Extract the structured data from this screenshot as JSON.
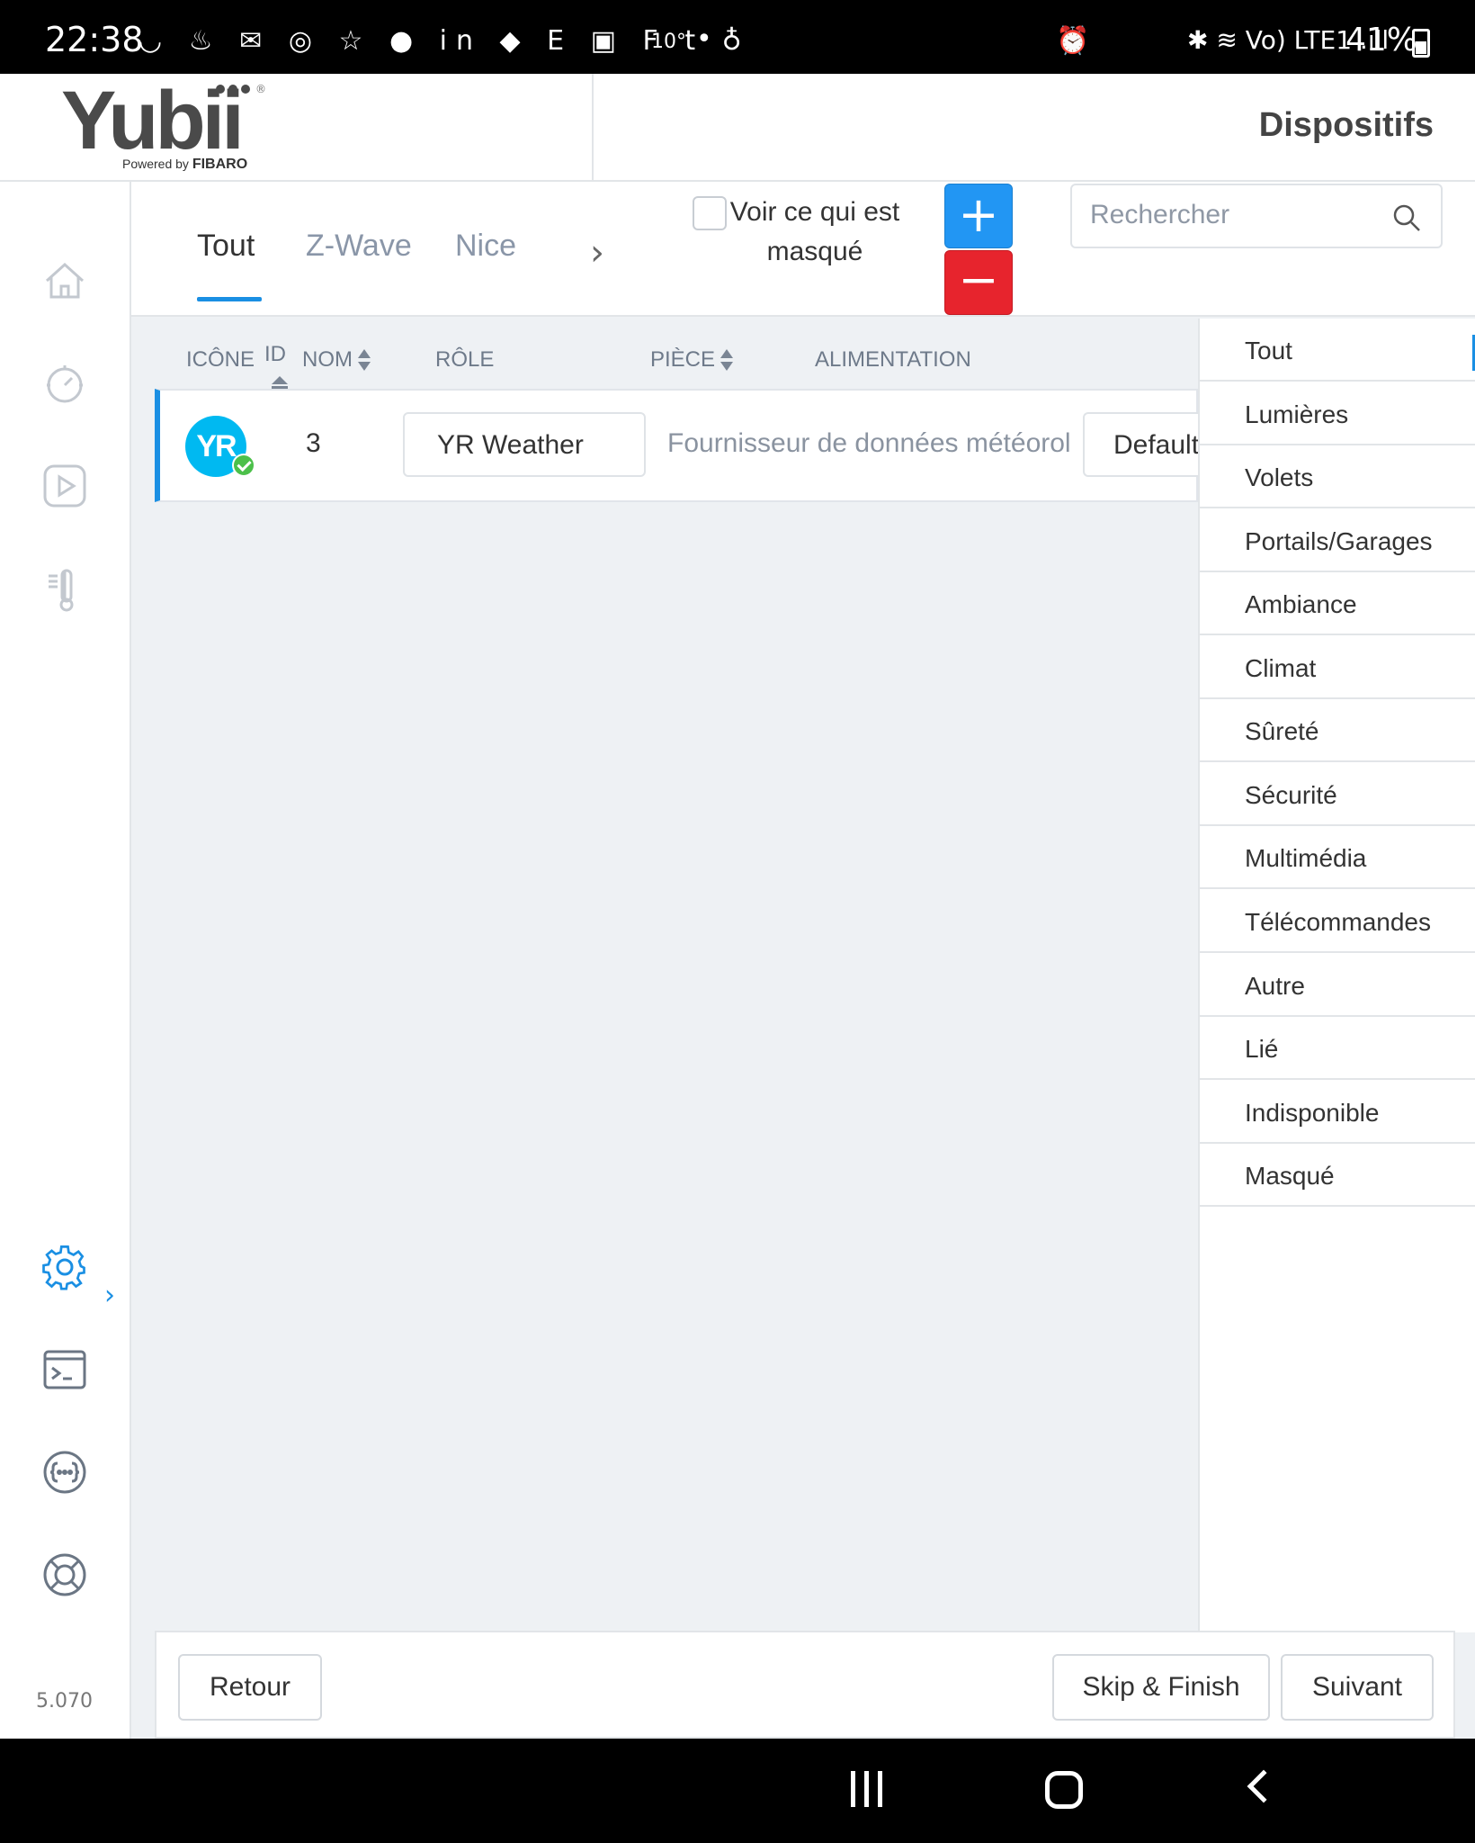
{
  "status_bar": {
    "time": "22:38",
    "notification_icons": "◡ ♨ ✉ ◎ ☆ ● in ◆ E ▣ F t ♁",
    "temperature": "10°",
    "dot": "•",
    "alarm_icon": "⏰",
    "right_icons": "✱ ≋ Vo) LTE1 .ıll",
    "battery": "41%"
  },
  "header": {
    "logo": {
      "text": "Yubii",
      "registered": "®",
      "powered_by": "Powered by",
      "brand": "FIBARO"
    },
    "title": "Dispositifs"
  },
  "sidebar": {
    "items": [
      {
        "icon": "home-icon"
      },
      {
        "icon": "dashboard-clock-icon"
      },
      {
        "icon": "scenes-play-icon"
      },
      {
        "icon": "thermometer-icon"
      },
      {
        "icon": "settings-gear-icon",
        "active": true
      },
      {
        "icon": "terminal-icon"
      },
      {
        "icon": "plugins-braces-icon"
      },
      {
        "icon": "help-lifebuoy-icon"
      }
    ],
    "version": "5.070"
  },
  "tabs": {
    "items": [
      {
        "label": "Tout",
        "active": true
      },
      {
        "label": "Z-Wave"
      },
      {
        "label": "Nice"
      }
    ],
    "next_icon": "chevron-right-icon"
  },
  "toolbar": {
    "show_hidden_label": "Voir ce qui est masqué",
    "show_hidden_checked": false,
    "add_label": "+",
    "remove_label": "−",
    "search_placeholder": "Rechercher"
  },
  "table": {
    "columns": {
      "icon": "ICÔNE",
      "id": "ID",
      "name": "NOM",
      "role": "RÔLE",
      "room": "PIÈCE",
      "power": "ALIMENTATION"
    },
    "rows": [
      {
        "icon_text": "YR",
        "id": "3",
        "name": "YR Weather",
        "role": "Fournisseur de données météorol",
        "room": "Default"
      }
    ]
  },
  "category_menu": {
    "items": [
      "Tout",
      "Lumières",
      "Volets",
      "Portails/Garages",
      "Ambiance",
      "Climat",
      "Sûreté",
      "Sécurité",
      "Multimédia",
      "Télécommandes",
      "Autre",
      "Lié",
      "Indisponible",
      "Masqué"
    ],
    "selected": "Tout"
  },
  "footer": {
    "back_label": "Retour",
    "skip_label": "Skip & Finish",
    "next_label": "Suivant"
  },
  "colors": {
    "accent": "#1a8fe3",
    "add": "#2296f3",
    "remove": "#e7242d",
    "online": "#4cc04a",
    "yr_brand": "#00b9f1"
  }
}
